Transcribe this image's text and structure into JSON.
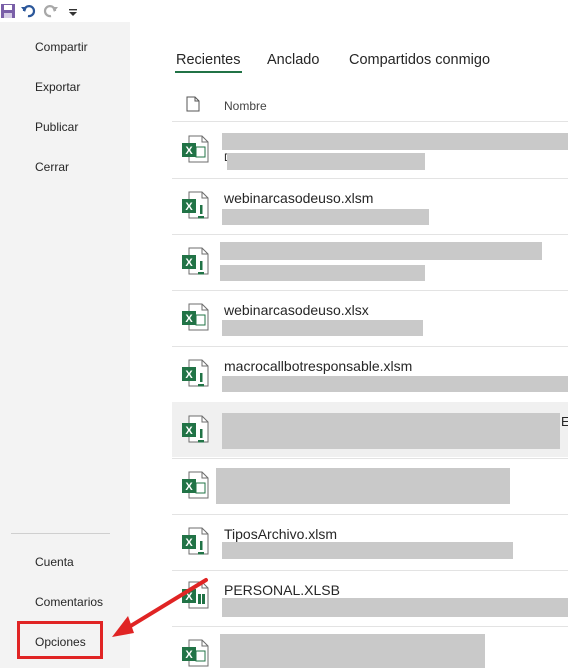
{
  "backstage": {
    "nav_top": [
      "Compartir",
      "Exportar",
      "Publicar",
      "Cerrar"
    ],
    "nav_bottom": [
      "Cuenta",
      "Comentarios",
      "Opciones"
    ],
    "highlighted": "Opciones"
  },
  "recent": {
    "tabs": [
      "Recientes",
      "Anclado",
      "Compartidos conmigo"
    ],
    "active_tab": "Recientes",
    "column_header": "Nombre",
    "files": [
      {
        "name": "",
        "obscured": true
      },
      {
        "name": "webinarcasodeuso.xlsm",
        "obscured": false
      },
      {
        "name": "",
        "obscured": true
      },
      {
        "name": "webinarcasodeuso.xlsx",
        "obscured": false
      },
      {
        "name": "macrocallbotresponsable.xlsm",
        "obscured": false
      },
      {
        "name": "",
        "obscured": true
      },
      {
        "name": "",
        "obscured": true
      },
      {
        "name": "TiposArchivo.xlsm",
        "obscured": false
      },
      {
        "name": "PERSONAL.XLSB",
        "obscured": false
      },
      {
        "name": "",
        "obscured": true
      }
    ],
    "fragment_text": "D",
    "edge_fragment": "E"
  },
  "colors": {
    "excel_green": "#217346",
    "annotation_red": "#e02424",
    "pane_bg": "#f3f3f3"
  }
}
